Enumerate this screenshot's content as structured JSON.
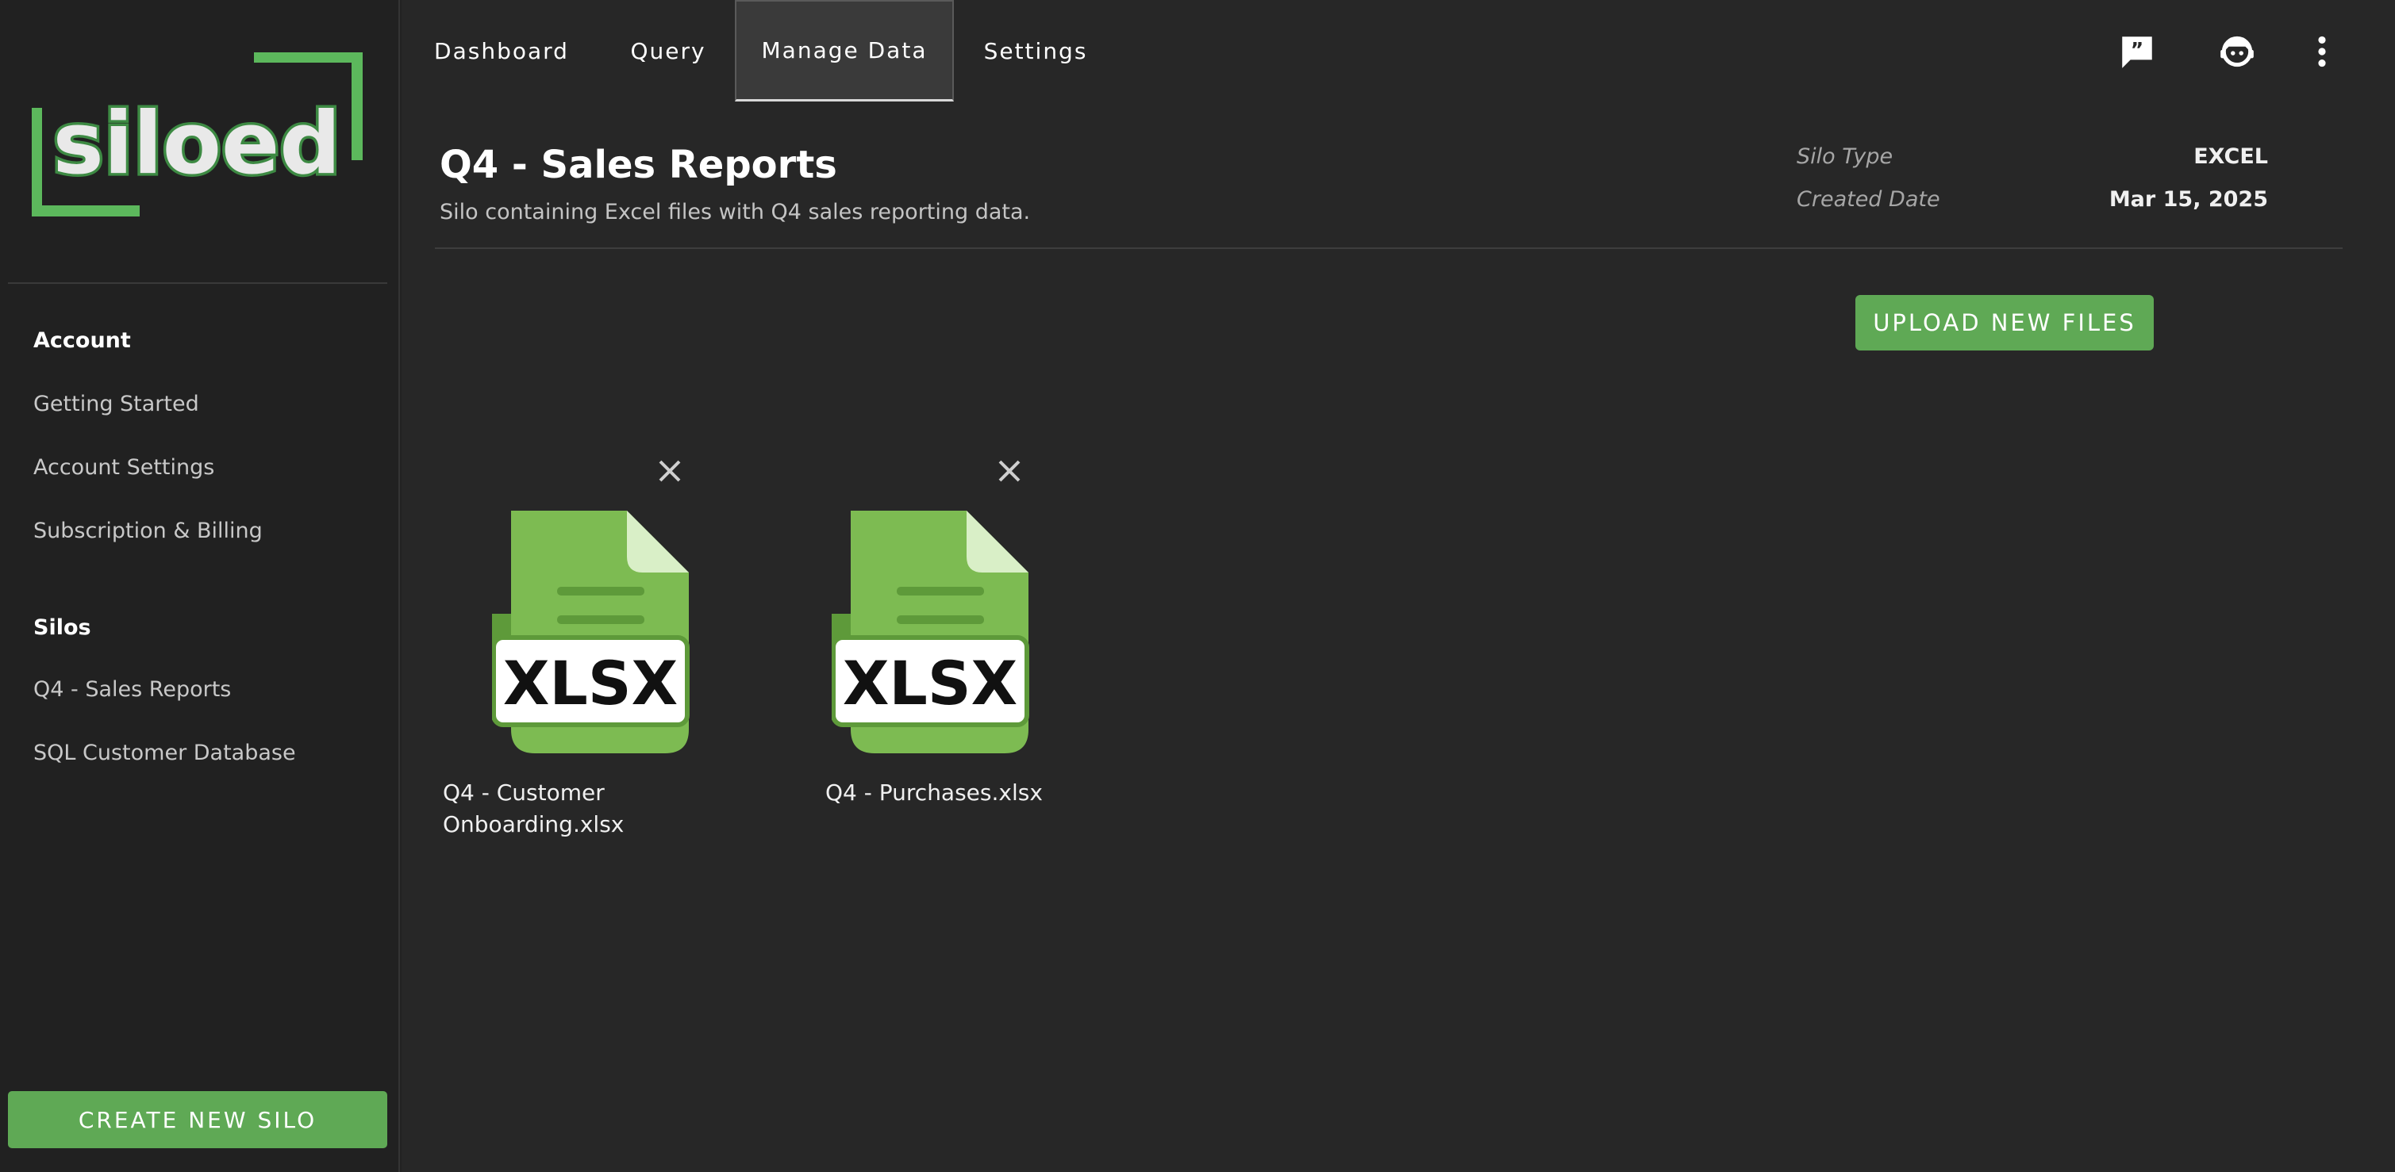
{
  "app": {
    "logo_text": "siloed"
  },
  "sidebar": {
    "sections": [
      {
        "title": "Account",
        "items": [
          "Getting Started",
          "Account Settings",
          "Subscription & Billing"
        ]
      },
      {
        "title": "Silos",
        "items": [
          "Q4 - Sales Reports",
          "SQL Customer Database"
        ]
      }
    ],
    "create_button": "CREATE NEW SILO"
  },
  "nav": {
    "tabs": [
      "Dashboard",
      "Query",
      "Manage Data",
      "Settings"
    ],
    "active_tab": "Manage Data",
    "icons": [
      "feedback-icon",
      "support-agent-icon",
      "more-vert-icon"
    ]
  },
  "silo": {
    "title": "Q4 - Sales Reports",
    "description": "Silo containing Excel files with Q4 sales reporting data.",
    "meta": [
      {
        "label": "Silo Type",
        "value": "EXCEL"
      },
      {
        "label": "Created Date",
        "value": "Mar 15, 2025"
      }
    ]
  },
  "upload_button": "UPLOAD NEW FILES",
  "files": [
    {
      "name_line1": "Q4 - Customer",
      "name_line2": "Onboarding.xlsx",
      "badge": "XLSX"
    },
    {
      "name_line1": "Q4 - Purchases.xlsx",
      "name_line2": "",
      "badge": "XLSX"
    }
  ],
  "colors": {
    "accent": "#5fa955",
    "background": "#272727",
    "sidebar": "#212121",
    "file_icon": "#7dbb52"
  }
}
